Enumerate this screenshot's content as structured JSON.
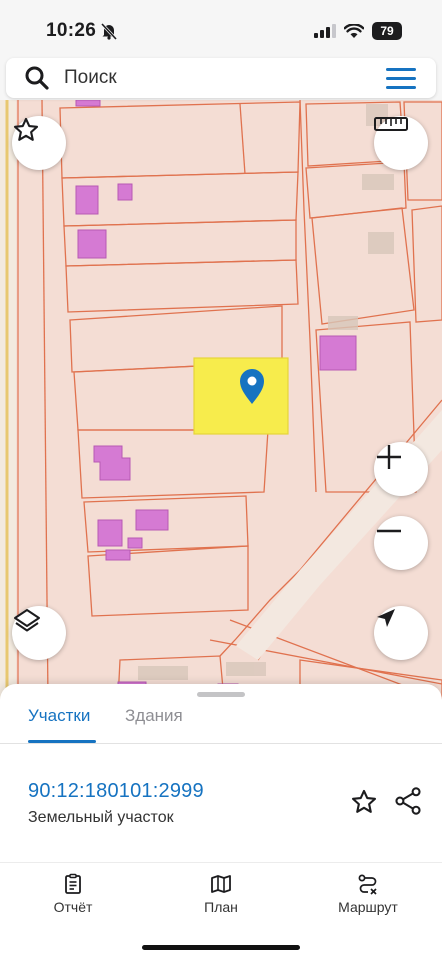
{
  "status": {
    "time": "10:26",
    "battery": "79",
    "icons": [
      "bell-slash-icon",
      "signal-icon",
      "wifi-icon",
      "battery-icon"
    ]
  },
  "search": {
    "placeholder": "Поиск"
  },
  "map": {
    "icons": [
      "star-icon",
      "ruler-icon",
      "layers-icon",
      "zoom-in-icon",
      "zoom-out-icon",
      "location-arrow-icon",
      "map-pin-icon"
    ],
    "colors": {
      "background": "#f4ddd4",
      "parcel_border": "#e0724f",
      "building": "#d57ad3",
      "selected": "#f7ec4c",
      "pin": "#1673c1"
    }
  },
  "sheet": {
    "tabs": [
      {
        "label": "Участки",
        "active": true
      },
      {
        "label": "Здания",
        "active": false
      }
    ],
    "cadastre_number": "90:12:180101:2999",
    "parcel_type": "Земельный участок"
  },
  "nav": [
    {
      "label": "Отчёт",
      "icon": "report-clipboard-icon"
    },
    {
      "label": "План",
      "icon": "map-plan-icon"
    },
    {
      "label": "Маршрут",
      "icon": "route-icon"
    }
  ]
}
